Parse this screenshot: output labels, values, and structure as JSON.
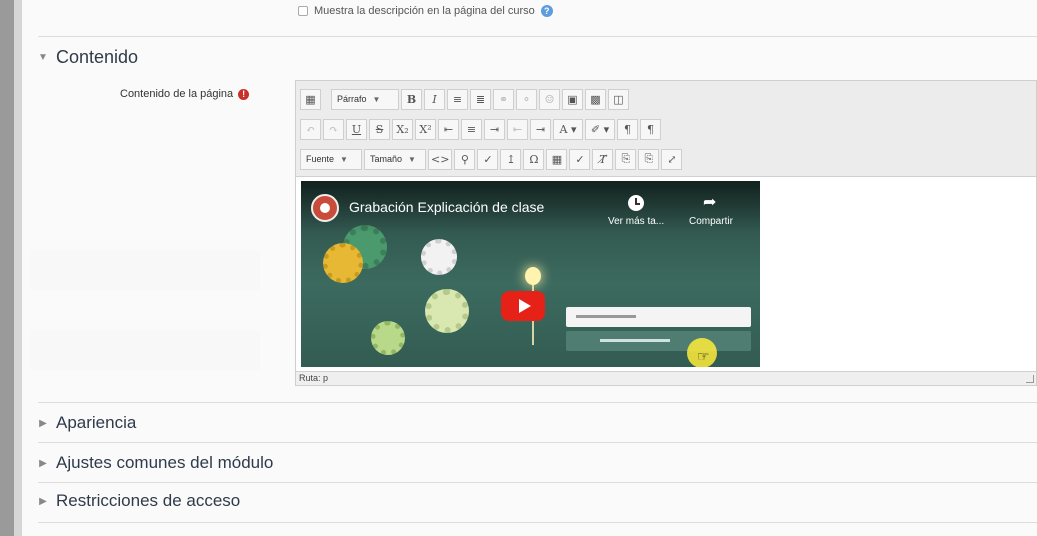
{
  "general": {
    "show_description_label": "Muestra la descripción en la página del curso"
  },
  "sections": {
    "content_title": "Contenido",
    "collapsed": [
      {
        "label": "Apariencia"
      },
      {
        "label": "Ajustes comunes del módulo"
      },
      {
        "label": "Restricciones de acceso"
      }
    ]
  },
  "field": {
    "label": "Contenido de la página",
    "required_icon": "exclamation-icon"
  },
  "editor": {
    "paragraph_select": "Párrafo",
    "font_select": "Fuente",
    "size_select": "Tamaño",
    "status_path": "Ruta: p",
    "row1_icons": [
      "toggle-toolbar-icon",
      "bold-icon",
      "italic-icon",
      "unordered-list-icon",
      "ordered-list-icon",
      "link-icon",
      "unlink-icon",
      "emoticon-icon",
      "image-icon",
      "media-icon",
      "file-manager-icon"
    ],
    "row2_icons": [
      "undo-icon",
      "redo-icon",
      "underline-icon",
      "strikethrough-icon",
      "subscript-icon",
      "superscript-icon",
      "align-left-icon",
      "align-center-icon",
      "align-right-icon",
      "outdent-icon",
      "indent-icon",
      "text-color-icon",
      "background-color-icon",
      "ltr-icon",
      "rtl-icon"
    ],
    "row3_icons": [
      "code-icon",
      "search-replace-icon",
      "spellcheck-icon",
      "upload-icon",
      "special-char-icon",
      "table-icon",
      "clean-format-icon",
      "remove-format-icon",
      "paste-text-icon",
      "paste-word-icon",
      "fullscreen-icon"
    ]
  },
  "video": {
    "title": "Grabación Explicación de clase",
    "watch_later": "Ver más ta...",
    "share": "Compartir"
  },
  "colors": {
    "required": "#c9302c",
    "help": "#5d9ddb",
    "youtube_red": "#e62117"
  }
}
